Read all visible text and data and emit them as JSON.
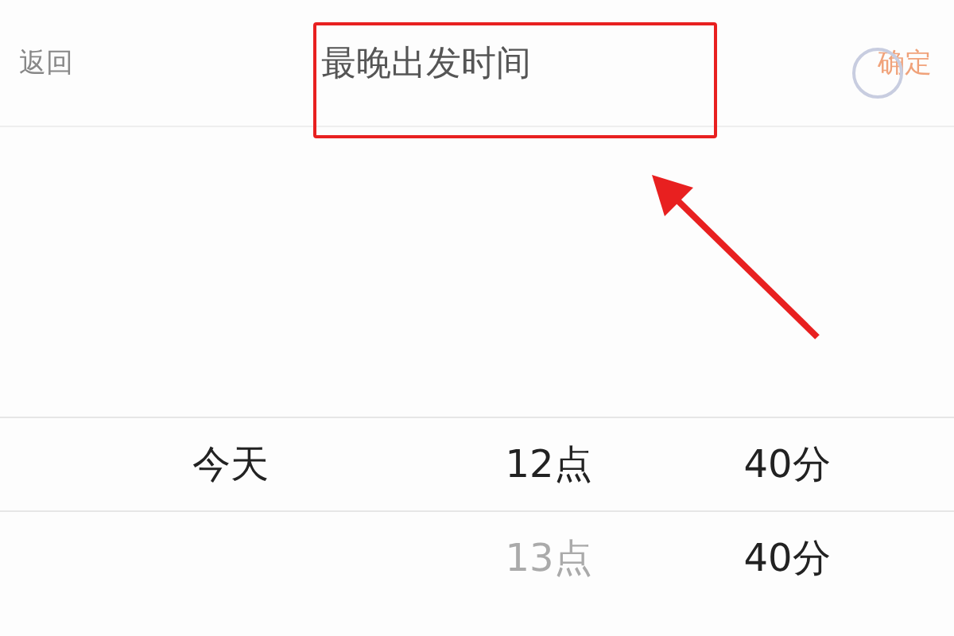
{
  "header": {
    "back": "返回",
    "title": "最晚出发时间",
    "confirm": "确定"
  },
  "picker_rows": [
    {
      "selected": true,
      "day": {
        "text": "今天",
        "dimmed": false
      },
      "hour": {
        "text": "12点",
        "dimmed": false
      },
      "minute": {
        "text": "40分",
        "dimmed": false
      }
    },
    {
      "selected": false,
      "hour": {
        "text": "13点",
        "dimmed": true
      },
      "minute": {
        "text": "40分",
        "dimmed": false
      }
    }
  ]
}
